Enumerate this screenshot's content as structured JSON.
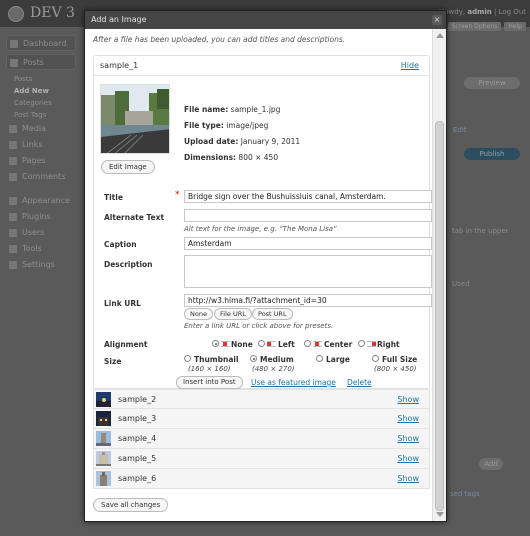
{
  "background": {
    "site_title": "DEV 3",
    "user_greeting": "Howdy,",
    "user_name": "admin",
    "logout": "Log Out",
    "tabs": [
      "Screen Options",
      "Help"
    ],
    "menu": [
      {
        "label": "Dashboard",
        "type": "head"
      },
      {
        "label": "Posts",
        "type": "head"
      },
      {
        "label": "Posts",
        "type": "sub"
      },
      {
        "label": "Add New",
        "type": "sub-active"
      },
      {
        "label": "Categories",
        "type": "sub"
      },
      {
        "label": "Post Tags",
        "type": "sub"
      },
      {
        "label": "Media",
        "type": "head"
      },
      {
        "label": "Links",
        "type": "head"
      },
      {
        "label": "Pages",
        "type": "head"
      },
      {
        "label": "Comments",
        "type": "head"
      },
      {
        "label": "Appearance",
        "type": "head"
      },
      {
        "label": "Plugins",
        "type": "head"
      },
      {
        "label": "Users",
        "type": "head"
      },
      {
        "label": "Tools",
        "type": "head"
      },
      {
        "label": "Settings",
        "type": "head"
      }
    ],
    "preview": "Preview",
    "publish": "Publish",
    "edit": "Edit",
    "used": "Used",
    "add": "Add",
    "upper_text": "tab in the upper",
    "tags_text": "sed tags"
  },
  "modal": {
    "title": "Add an Image",
    "close": "×",
    "intro": "After a file has been uploaded, you can add titles and descriptions.",
    "item": {
      "filename_header": "sample_1",
      "hide": "Hide",
      "edit_image": "Edit Image",
      "meta": {
        "file_name_label": "File name:",
        "file_name": "sample_1.jpg",
        "file_type_label": "File type:",
        "file_type": "image/jpeg",
        "upload_date_label": "Upload date:",
        "upload_date": "January 9, 2011",
        "dimensions_label": "Dimensions:",
        "dimensions": "800 × 450"
      },
      "title_label": "Title",
      "required_mark": "*",
      "title_value": "Bridge sign over the Bushuissluis canal, Amsterdam.",
      "alt_label": "Alternate Text",
      "alt_value": "",
      "alt_help": "Alt text for the image, e.g. “The Mona Lisa”",
      "caption_label": "Caption",
      "caption_value": "Amsterdam",
      "description_label": "Description",
      "description_value": "",
      "link_label": "Link URL",
      "link_value": "http://w3.hima.fi/?attachment_id=30",
      "link_buttons": [
        "None",
        "File URL",
        "Post URL"
      ],
      "link_help": "Enter a link URL or click above for presets.",
      "alignment_label": "Alignment",
      "alignment_options": [
        "None",
        "Left",
        "Center",
        "Right"
      ],
      "alignment_selected": "None",
      "size_label": "Size",
      "size_options": [
        {
          "label": "Thumbnail",
          "dims": "(160 × 160)"
        },
        {
          "label": "Medium",
          "dims": "(480 × 270)"
        },
        {
          "label": "Large",
          "dims": ""
        },
        {
          "label": "Full Size",
          "dims": "(800 × 450)"
        }
      ],
      "size_selected": "Medium",
      "insert_button": "Insert into Post",
      "featured_link": "Use as featured image",
      "delete_link": "Delete"
    },
    "others": [
      {
        "name": "sample_2",
        "show": "Show"
      },
      {
        "name": "sample_3",
        "show": "Show"
      },
      {
        "name": "sample_4",
        "show": "Show"
      },
      {
        "name": "sample_5",
        "show": "Show"
      },
      {
        "name": "sample_6",
        "show": "Show"
      }
    ],
    "save_all": "Save all changes"
  },
  "colors": {
    "link": "#21759b",
    "titlebar": "#464646",
    "required": "#dd0000"
  }
}
